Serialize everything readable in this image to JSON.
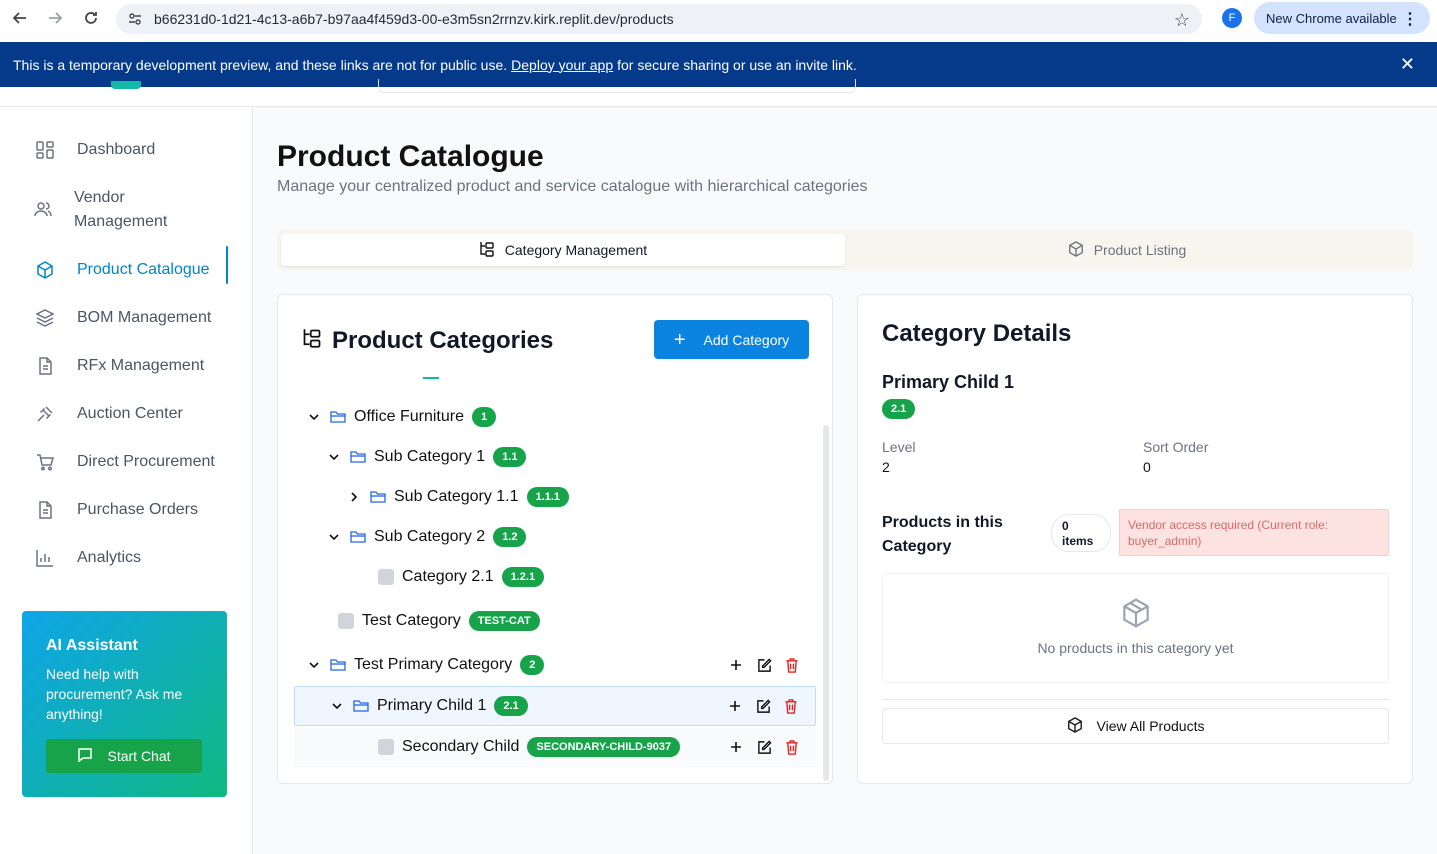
{
  "browser": {
    "url": "b66231d0-1d21-4c13-a6b7-b97aa4f459d3-00-e3m5sn2rrnzv.kirk.replit.dev/products",
    "profile_initial": "F",
    "update_label": "New Chrome available"
  },
  "banner": {
    "text_before": "This is a temporary development preview, and these links are not for public use.",
    "link": "Deploy your app",
    "text_after": "for secure sharing or use an invite link."
  },
  "sidebar": {
    "items": [
      {
        "label": "Dashboard",
        "icon": "dashboard-icon"
      },
      {
        "label": "Vendor Management",
        "icon": "users-icon"
      },
      {
        "label": "Product Catalogue",
        "icon": "package-icon"
      },
      {
        "label": "BOM Management",
        "icon": "layers-icon"
      },
      {
        "label": "RFx Management",
        "icon": "file-icon"
      },
      {
        "label": "Auction Center",
        "icon": "gavel-icon"
      },
      {
        "label": "Direct Procurement",
        "icon": "cart-icon"
      },
      {
        "label": "Purchase Orders",
        "icon": "file-text-icon"
      },
      {
        "label": "Analytics",
        "icon": "bar-chart-icon"
      }
    ],
    "ai": {
      "title": "AI Assistant",
      "desc": "Need help with procurement? Ask me anything!",
      "button": "Start Chat"
    }
  },
  "page": {
    "title": "Product Catalogue",
    "subtitle": "Manage your centralized product and service catalogue with hierarchical categories",
    "tabs": [
      {
        "label": "Category Management"
      },
      {
        "label": "Product Listing"
      }
    ]
  },
  "categories": {
    "title": "Product Categories",
    "add_button": "Add Category",
    "rows": [
      {
        "name": "Office Furniture",
        "code": "1"
      },
      {
        "name": "Sub Category 1",
        "code": "1.1"
      },
      {
        "name": "Sub Category 1.1",
        "code": "1.1.1"
      },
      {
        "name": "Sub Category 2",
        "code": "1.2"
      },
      {
        "name": "Category 2.1",
        "code": "1.2.1"
      },
      {
        "name": "Test Category",
        "code": "TEST-CAT"
      },
      {
        "name": "Test Primary Category",
        "code": "2"
      },
      {
        "name": "Primary Child 1",
        "code": "2.1"
      },
      {
        "name": "Secondary Child",
        "code": "SECONDARY-CHILD-9037"
      }
    ]
  },
  "details": {
    "title": "Category Details",
    "name": "Primary Child 1",
    "code": "2.1",
    "level_label": "Level",
    "level_value": "2",
    "sort_label": "Sort Order",
    "sort_value": "0",
    "products_title": "Products in this Category",
    "items_count": "0 items",
    "vendor_alert": "Vendor access required (Current role: buyer_admin)",
    "empty_text": "No products in this category yet",
    "view_all": "View All Products"
  },
  "colors": {
    "accent": "#0284c7",
    "badge": "#16a34a",
    "banner": "#053a8a"
  }
}
